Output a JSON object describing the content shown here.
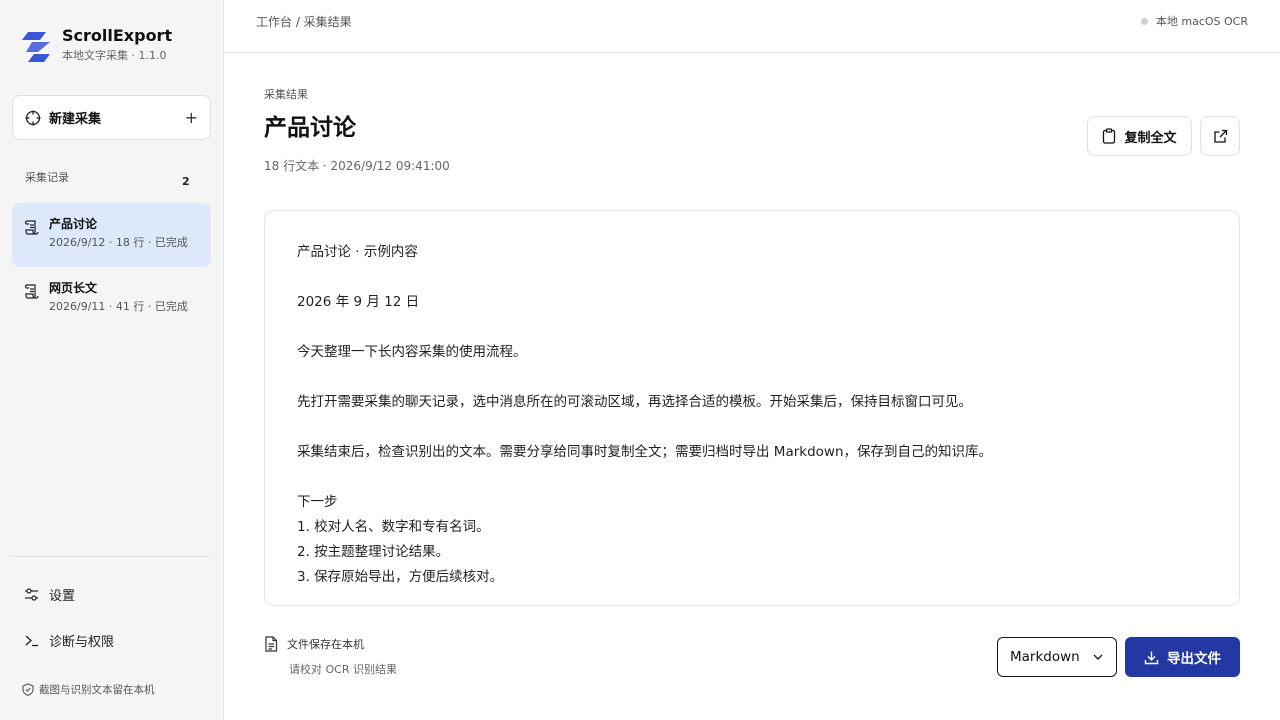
{
  "app": {
    "name": "ScrollExport",
    "subtitle": "本地文字采集 · 1.1.0"
  },
  "sidebar": {
    "new_capture_label": "新建采集",
    "new_capture_plus": "+",
    "records_label": "采集记录",
    "records_count": "2",
    "records": [
      {
        "title": "产品讨论",
        "meta": "2026/9/12 · 18 行 · 已完成",
        "active": true
      },
      {
        "title": "网页长文",
        "meta": "2026/9/11 · 41 行 · 已完成",
        "active": false
      }
    ],
    "settings_label": "设置",
    "diagnostics_label": "诊断与权限",
    "privacy_note": "截图与识别文本留在本机"
  },
  "topbar": {
    "breadcrumb": "工作台 / 采集结果",
    "ocr_status": "本地 macOS OCR"
  },
  "main": {
    "eyebrow": "采集结果",
    "title": "产品讨论",
    "meta": "18 行文本 · 2026/9/12 09:41:00",
    "copy_label": "复制全文",
    "lines": [
      "产品讨论 · 示例内容",
      "",
      "2026 年 9 月 12 日",
      "",
      "今天整理一下长内容采集的使用流程。",
      "",
      "先打开需要采集的聊天记录，选中消息所在的可滚动区域，再选择合适的模板。开始采集后，保持目标窗口可见。",
      "",
      "采集结束后，检查识别出的文本。需要分享给同事时复制全文；需要归档时导出 Markdown，保存到自己的知识库。",
      "",
      "下一步",
      "1. 校对人名、数字和专有名词。",
      "2. 按主题整理讨论结果。",
      "3. 保存原始导出，方便后续核对。"
    ]
  },
  "footer": {
    "save_note": "文件保存在本机",
    "save_sub": "请校对 OCR 识别结果",
    "format_value": "Markdown",
    "export_label": "导出文件"
  },
  "colors": {
    "accent": "#2438a3",
    "active_bg": "#dde8fb",
    "logo": "#3a55d8"
  }
}
